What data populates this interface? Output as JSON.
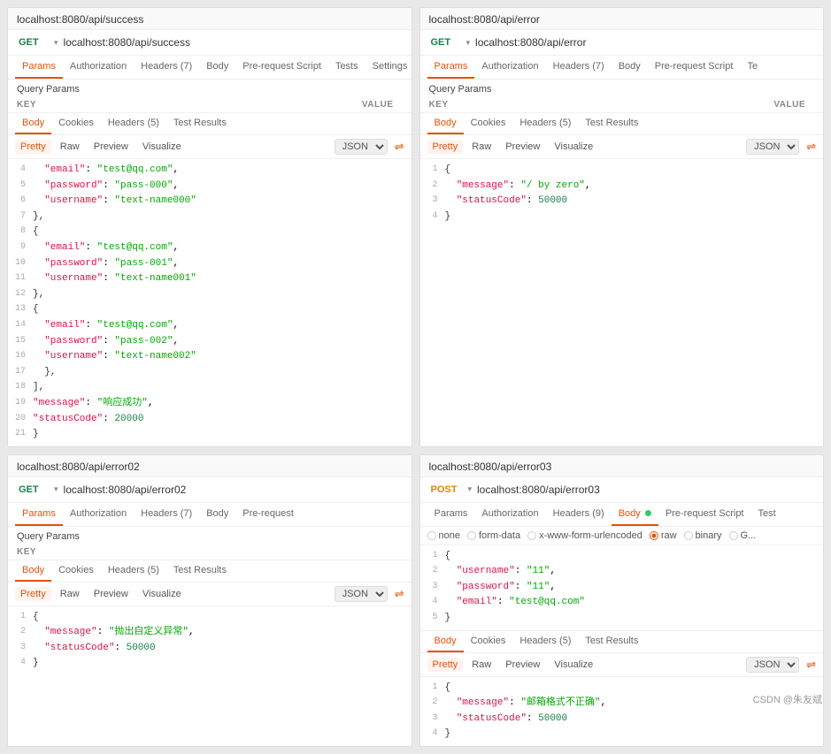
{
  "panels": {
    "top_left": {
      "title": "localhost:8080/api/success",
      "method": "GET",
      "url": "localhost:8080/api/success",
      "tabs": [
        "Params",
        "Authorization",
        "Headers (7)",
        "Body",
        "Pre-request Script",
        "Tests",
        "Settings"
      ],
      "active_tab": "Params",
      "query_params_label": "Query Params",
      "kv_headers": [
        "KEY",
        "VALUE"
      ],
      "body_tabs": [
        "Body",
        "Cookies",
        "Headers (5)",
        "Test Results"
      ],
      "active_body_tab": "Body",
      "format_buttons": [
        "Pretty",
        "Raw",
        "Preview",
        "Visualize"
      ],
      "active_format": "Pretty",
      "format_type": "JSON",
      "code_lines": [
        {
          "num": "4",
          "content": "  \"email\": \"test@qq.com\","
        },
        {
          "num": "5",
          "content": "  \"password\": \"pass-000\","
        },
        {
          "num": "6",
          "content": "  \"username\": \"text-name000\""
        },
        {
          "num": "7",
          "content": "},"
        },
        {
          "num": "8",
          "content": "{"
        },
        {
          "num": "9",
          "content": "  \"email\": \"test@qq.com\","
        },
        {
          "num": "10",
          "content": "  \"password\": \"pass-001\","
        },
        {
          "num": "11",
          "content": "  \"username\": \"text-name001\""
        },
        {
          "num": "12",
          "content": "},"
        },
        {
          "num": "13",
          "content": "{"
        },
        {
          "num": "14",
          "content": "  \"email\": \"test@qq.com\","
        },
        {
          "num": "15",
          "content": "  \"password\": \"pass-002\","
        },
        {
          "num": "16",
          "content": "  \"username\": \"text-name002\""
        },
        {
          "num": "17",
          "content": "  },"
        },
        {
          "num": "18",
          "content": "],"
        },
        {
          "num": "19",
          "content": "\"message\": \"响应成功\","
        },
        {
          "num": "20",
          "content": "\"statusCode\": 20000"
        },
        {
          "num": "21",
          "content": "}"
        }
      ]
    },
    "top_right": {
      "title": "localhost:8080/api/error",
      "method": "GET",
      "url": "localhost:8080/api/error",
      "tabs": [
        "Params",
        "Authorization",
        "Headers (7)",
        "Body",
        "Pre-request Script",
        "Te"
      ],
      "active_tab": "Params",
      "query_params_label": "Query Params",
      "kv_headers": [
        "KEY",
        "VALUE"
      ],
      "body_tabs": [
        "Body",
        "Cookies",
        "Headers (5)",
        "Test Results"
      ],
      "active_body_tab": "Body",
      "format_buttons": [
        "Pretty",
        "Raw",
        "Preview",
        "Visualize"
      ],
      "active_format": "Pretty",
      "format_type": "JSON",
      "code_lines": [
        {
          "num": "1",
          "content": "{"
        },
        {
          "num": "2",
          "content": "  \"message\": \"/ by zero\","
        },
        {
          "num": "3",
          "content": "  \"statusCode\": 50000"
        },
        {
          "num": "4",
          "content": "}"
        }
      ]
    },
    "bottom_left": {
      "title": "localhost:8080/api/error02",
      "method": "GET",
      "url": "localhost:8080/api/error02",
      "tabs": [
        "Params",
        "Authorization",
        "Headers (7)",
        "Body",
        "Pre-request"
      ],
      "active_tab": "Params",
      "query_params_label": "Query Params",
      "kv_headers": [
        "KEY"
      ],
      "body_tabs": [
        "Body",
        "Cookies",
        "Headers (5)",
        "Test Results"
      ],
      "active_body_tab": "Body",
      "format_buttons": [
        "Pretty",
        "Raw",
        "Preview",
        "Visualize"
      ],
      "active_format": "Pretty",
      "format_type": "JSON",
      "code_lines": [
        {
          "num": "1",
          "content": "{"
        },
        {
          "num": "2",
          "content": "  \"message\": \"抛出自定义异常\","
        },
        {
          "num": "3",
          "content": "  \"statusCode\": 50000"
        },
        {
          "num": "4",
          "content": "}"
        }
      ]
    },
    "bottom_right": {
      "title": "localhost:8080/api/error03",
      "method": "POST",
      "url": "localhost:8080/api/error03",
      "tabs": [
        "Params",
        "Authorization",
        "Headers (9)",
        "Body",
        "Pre-request Script",
        "Test"
      ],
      "active_tab": "Body",
      "radio_options": [
        "none",
        "form-data",
        "x-www-form-urlencoded",
        "raw",
        "binary",
        "G..."
      ],
      "active_radio": "raw",
      "input_code_lines": [
        {
          "num": "1",
          "content": "{"
        },
        {
          "num": "2",
          "content": "  \"username\": \"11\","
        },
        {
          "num": "3",
          "content": "  \"password\": \"11\","
        },
        {
          "num": "4",
          "content": "  \"email\": \"test@qq.com\""
        },
        {
          "num": "5",
          "content": "}"
        }
      ],
      "body_tabs": [
        "Body",
        "Cookies",
        "Headers (5)",
        "Test Results"
      ],
      "active_body_tab": "Body",
      "format_buttons": [
        "Pretty",
        "Raw",
        "Preview",
        "Visualize"
      ],
      "active_format": "Pretty",
      "format_type": "JSON",
      "code_lines": [
        {
          "num": "1",
          "content": "{"
        },
        {
          "num": "2",
          "content": "  \"message\": \"邮箱格式不正确\","
        },
        {
          "num": "3",
          "content": "  \"statusCode\": 50000"
        },
        {
          "num": "4",
          "content": "}"
        }
      ]
    }
  },
  "watermark": "CSDN @朱友斌"
}
